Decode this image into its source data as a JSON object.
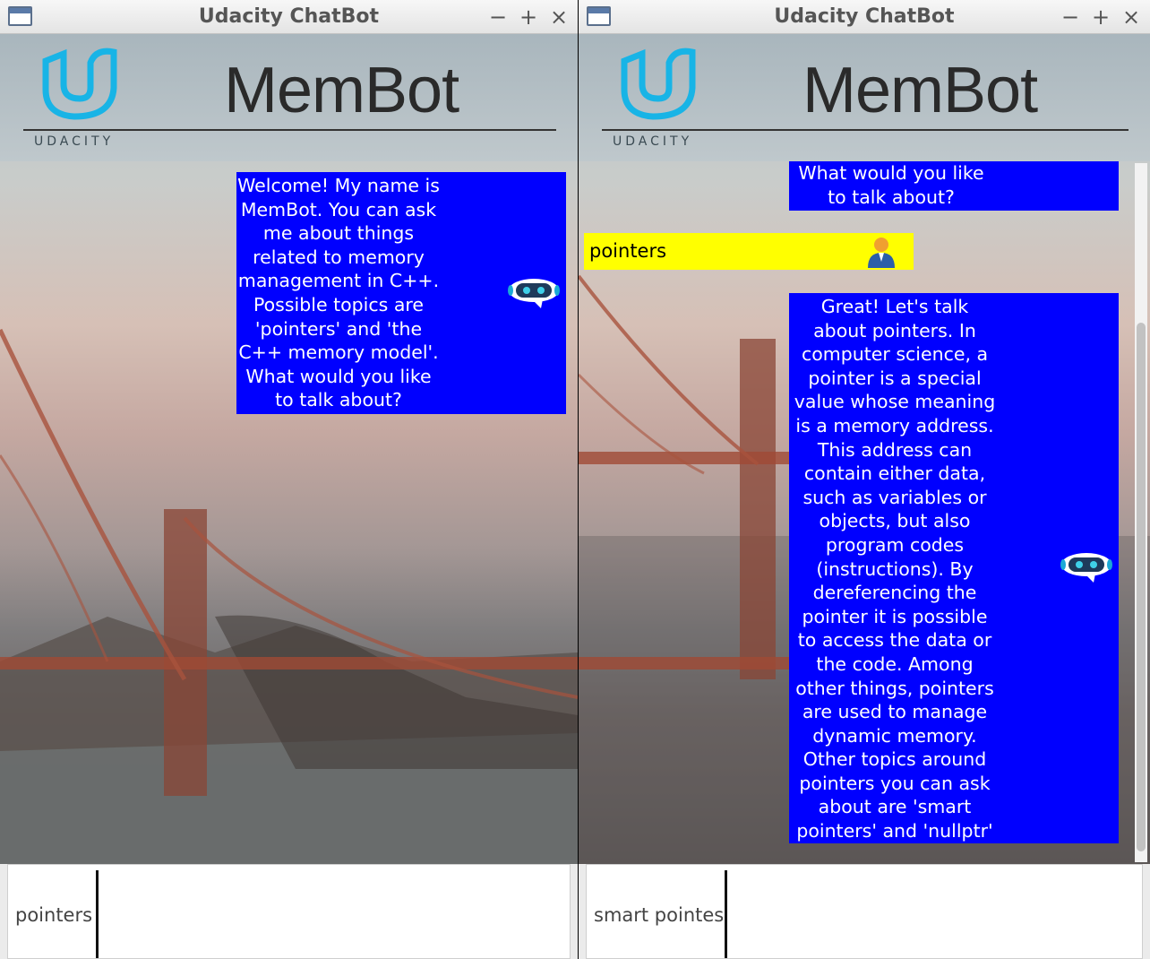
{
  "left_window": {
    "title": "Udacity ChatBot",
    "controls": {
      "minimize": "−",
      "maximize": "+",
      "close": "×"
    },
    "brand": {
      "logo_text": "UDACITY",
      "app_name": "MemBot"
    },
    "messages": [
      {
        "type": "bot",
        "text": "Welcome! My name is\nMemBot. You can ask\nme about things\nrelated to memory\nmanagement in C++.\nPossible topics are\n'pointers' and 'the\nC++ memory model'.\nWhat would you like\nto talk about?"
      }
    ],
    "input": {
      "value": "pointers"
    }
  },
  "right_window": {
    "title": "Udacity ChatBot",
    "controls": {
      "minimize": "−",
      "maximize": "+",
      "close": "×"
    },
    "brand": {
      "logo_text": "UDACITY",
      "app_name": "MemBot"
    },
    "messages": [
      {
        "type": "bot",
        "text": "What would you like\nto talk about?"
      },
      {
        "type": "user",
        "text": "pointers"
      },
      {
        "type": "bot",
        "text": "Great! Let's talk\nabout pointers. In\ncomputer science, a\npointer is a special\nvalue whose meaning\nis a memory address.\nThis address can\ncontain either data,\nsuch as variables or\nobjects, but also\nprogram codes\n(instructions). By\ndereferencing the\npointer it is possible\nto access the data or\nthe code. Among\nother things, pointers\nare used to manage\ndynamic memory.\nOther topics around\npointers you can ask\nabout are 'smart\npointers' and 'nullptr'"
      }
    ],
    "input": {
      "value": "smart pointes"
    }
  },
  "colors": {
    "bot_bubble": "#0000ff",
    "user_bubble": "#ffff00",
    "udacity_blue": "#18b4e6"
  }
}
